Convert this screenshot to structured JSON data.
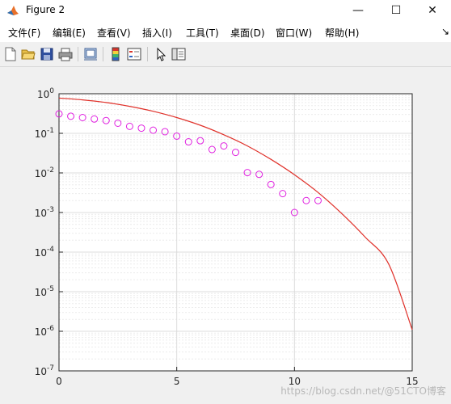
{
  "window": {
    "title": "Figure 2",
    "minimize_glyph": "—",
    "maximize_glyph": "☐",
    "close_glyph": "✕"
  },
  "menu": {
    "items": [
      {
        "label": "文件(F)"
      },
      {
        "label": "编辑(E)"
      },
      {
        "label": "查看(V)"
      },
      {
        "label": "插入(I)"
      },
      {
        "label": "工具(T)"
      },
      {
        "label": "桌面(D)"
      },
      {
        "label": "窗口(W)"
      },
      {
        "label": "帮助(H)"
      }
    ],
    "overflow": "↘"
  },
  "toolbar": {
    "icons": [
      "new-file-icon",
      "open-folder-icon",
      "save-icon",
      "print-icon",
      "link-figure-icon",
      "colorbar-icon",
      "legend-icon",
      "pointer-icon",
      "property-editor-icon"
    ]
  },
  "watermark": "https://blog.csdn.net/@51CTO博客",
  "colors": {
    "curve": "#e0312a",
    "markers": "#e020e0",
    "axes_bg": "#ffffff",
    "grid": "#dcdcdc"
  },
  "chart_data": {
    "type": "scatter",
    "title": "",
    "xlabel": "",
    "ylabel": "",
    "xlim": [
      0,
      15
    ],
    "ylim": [
      1e-07,
      1
    ],
    "yscale": "log",
    "grid": true,
    "x_ticks": [
      {
        "value": 0,
        "label": "0"
      },
      {
        "value": 5,
        "label": "5"
      },
      {
        "value": 10,
        "label": "10"
      },
      {
        "value": 15,
        "label": "15"
      }
    ],
    "y_ticks": [
      {
        "value": 1,
        "base": "10",
        "exp": "0"
      },
      {
        "value": 0.1,
        "base": "10",
        "exp": "-1"
      },
      {
        "value": 0.01,
        "base": "10",
        "exp": "-2"
      },
      {
        "value": 0.001,
        "base": "10",
        "exp": "-3"
      },
      {
        "value": 0.0001,
        "base": "10",
        "exp": "-4"
      },
      {
        "value": 1e-05,
        "base": "10",
        "exp": "-5"
      },
      {
        "value": 1e-06,
        "base": "10",
        "exp": "-6"
      },
      {
        "value": 1e-07,
        "base": "10",
        "exp": "-7"
      }
    ],
    "series": [
      {
        "style": "line",
        "color": "#e0312a",
        "x": [
          0,
          1,
          2,
          3,
          4,
          5,
          6,
          7,
          8,
          9,
          10,
          11,
          12,
          13,
          14,
          15
        ],
        "y": [
          0.78,
          0.7,
          0.6,
          0.48,
          0.36,
          0.25,
          0.16,
          0.092,
          0.048,
          0.022,
          0.009,
          0.0032,
          0.00095,
          0.00024,
          5e-05,
          1.1e-06
        ]
      },
      {
        "style": "markers",
        "color": "#e020e0",
        "x": [
          0,
          0.5,
          1,
          1.5,
          2,
          2.5,
          3,
          3.5,
          4,
          4.5,
          5,
          5.5,
          6,
          6.5,
          7,
          7.5,
          8,
          8.5,
          9,
          9.5,
          10,
          10.5,
          11
        ],
        "y": [
          0.31,
          0.27,
          0.25,
          0.23,
          0.21,
          0.18,
          0.15,
          0.135,
          0.12,
          0.11,
          0.085,
          0.061,
          0.065,
          0.039,
          0.048,
          0.033,
          0.0102,
          0.0092,
          0.0051,
          0.003,
          0.001,
          0.002,
          0.002
        ]
      }
    ]
  }
}
